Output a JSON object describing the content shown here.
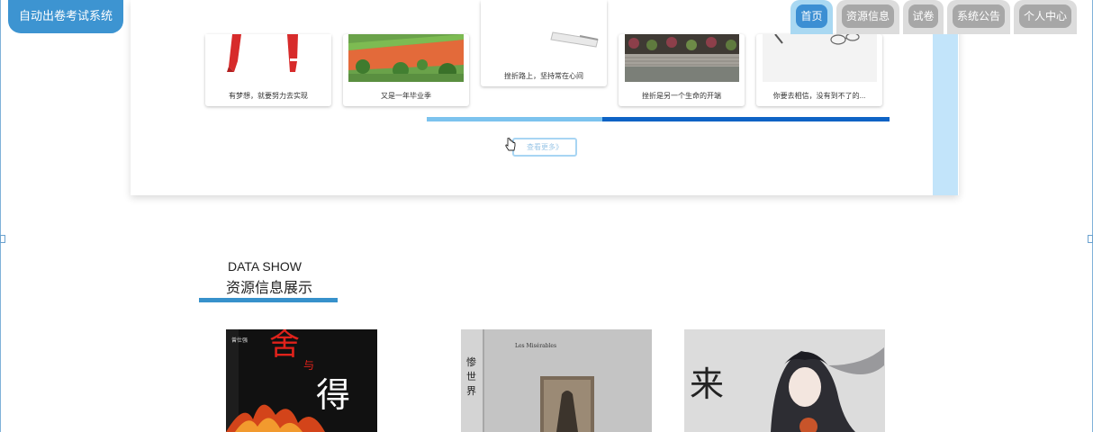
{
  "app": {
    "title": "自动出卷考试系统"
  },
  "nav": {
    "items": [
      {
        "label": "首页",
        "active": true
      },
      {
        "label": "资源信息",
        "active": false
      },
      {
        "label": "试卷",
        "active": false
      },
      {
        "label": "系统公告",
        "active": false
      },
      {
        "label": "个人中心",
        "active": false
      }
    ]
  },
  "carousel": {
    "items": [
      {
        "caption": "有梦想，就要努力去实现",
        "image": "red-pencils"
      },
      {
        "caption": "又是一年毕业季",
        "image": "campus-track"
      },
      {
        "caption": "挫折路上，坚持常在心间",
        "image": "notebook"
      },
      {
        "caption": "挫折是另一个生命的开端",
        "image": "garden"
      },
      {
        "caption": "你要去相信，没有到不了的...",
        "image": "glasses-sketch"
      }
    ],
    "more_label": "查看更多》",
    "progress": 0.38
  },
  "data_show": {
    "title_en": "DATA SHOW",
    "title_cn": "资源信息展示",
    "books": [
      {
        "title": "舍与得",
        "author": "曾仕强",
        "image": "book-fire"
      },
      {
        "title": "悲惨世界",
        "subtitle": "Les Misérables",
        "image": "book-grey"
      },
      {
        "title": "来",
        "image": "book-anime"
      }
    ]
  },
  "colors": {
    "brand": "#3d94d1",
    "nav_inactive": "#a7a7a7",
    "nav_active": "#3c8fd3",
    "progress_dark": "#0e63c5",
    "progress_light": "#7cc3ee",
    "section_bar": "#3791cb"
  }
}
